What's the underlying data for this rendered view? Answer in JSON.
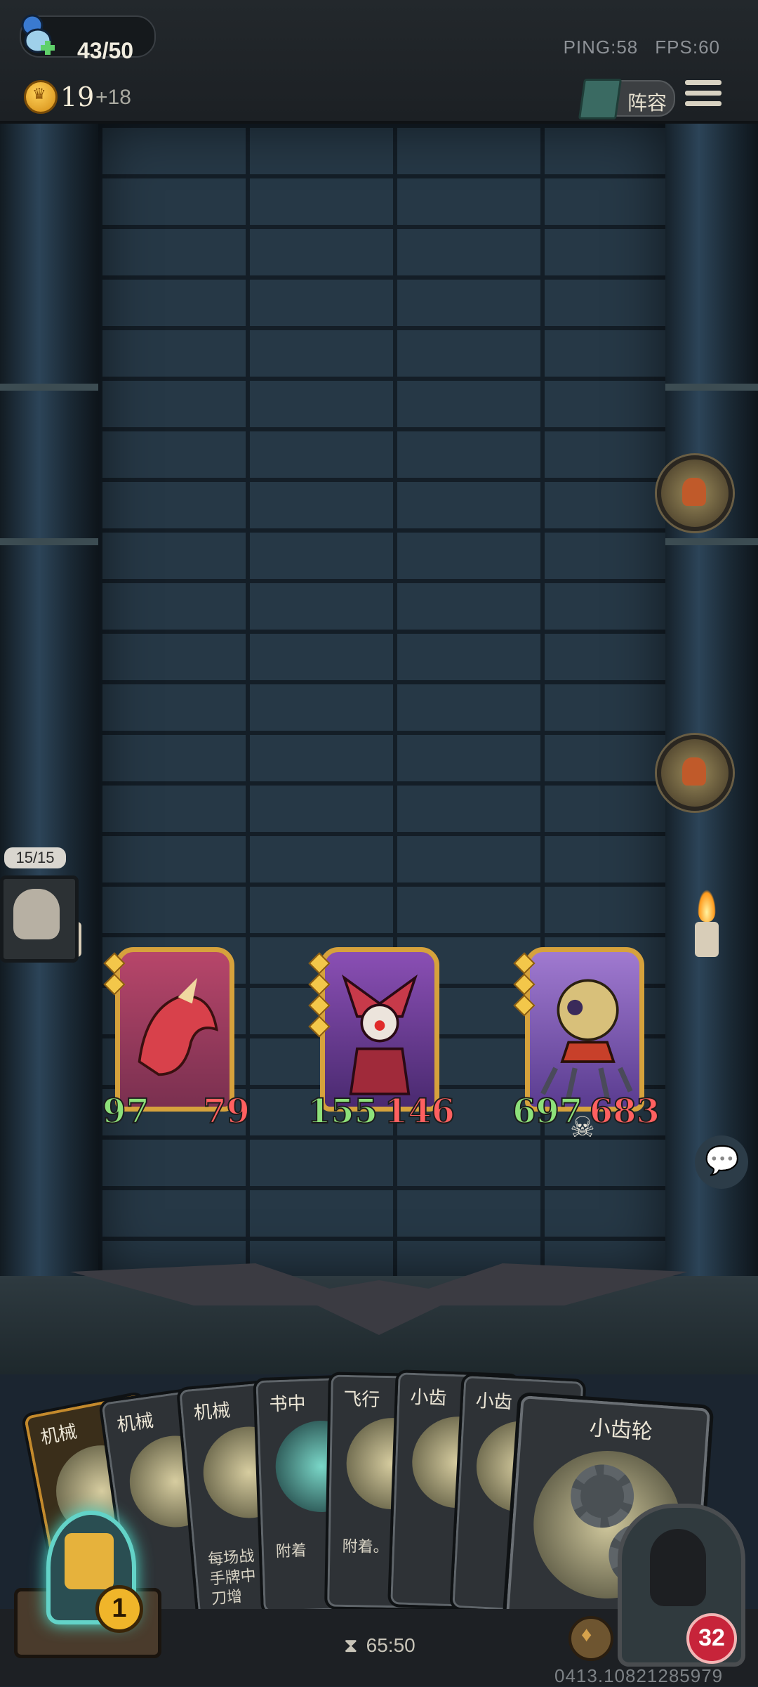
{
  "header": {
    "mana": "43/50",
    "gold": "19",
    "gold_income": "+18",
    "ping": "PING:58",
    "fps": "FPS:60",
    "lineup_label": "阵容"
  },
  "board": {
    "hero_count": "15/15",
    "minions": [
      {
        "attack": "97",
        "health": "79",
        "color": "#c0414a"
      },
      {
        "attack": "155",
        "health": "146",
        "color": "#7a3f9a"
      },
      {
        "attack": "697",
        "health": "683",
        "color": "#6b4aa0"
      }
    ]
  },
  "hand": {
    "cards": [
      {
        "name": "机械",
        "desc": ""
      },
      {
        "name": "机械",
        "desc": ""
      },
      {
        "name": "机械",
        "desc": "每场战\n手牌中\n刀增"
      },
      {
        "name": "书中",
        "desc": "附着"
      },
      {
        "name": "飞行",
        "desc": "附着。"
      },
      {
        "name": "小齿",
        "desc": ""
      },
      {
        "name": "小齿",
        "desc": ""
      }
    ],
    "featured_card": {
      "name": "小齿轮"
    }
  },
  "footer": {
    "refresh_cost": "1",
    "timer": "65:50",
    "player_health": "32",
    "seed": "0413.10821285979"
  }
}
